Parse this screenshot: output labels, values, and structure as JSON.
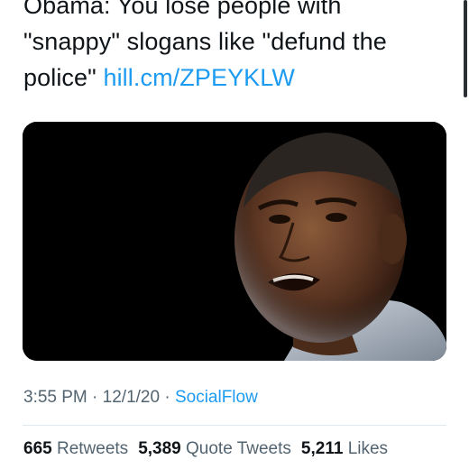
{
  "tweet": {
    "text_line1": "Obama: You lose people with",
    "text_line2": "\"snappy\" slogans like \"defund the",
    "text_line3": "police\"",
    "link": "hill.cm/ZPEYKLW",
    "media_icon": "photo-of-speaker"
  },
  "meta": {
    "time": "3:55 PM",
    "sep1": " · ",
    "date": "12/1/20",
    "sep2": " · ",
    "source": "SocialFlow"
  },
  "stats": {
    "retweets_count": "665",
    "retweets_label": "Retweets",
    "quotes_count": "5,389",
    "quotes_label": "Quote Tweets",
    "likes_count": "5,211",
    "likes_label": "Likes"
  },
  "colors": {
    "link": "#1d9bf0",
    "muted": "#536471",
    "text": "#0f1419"
  }
}
